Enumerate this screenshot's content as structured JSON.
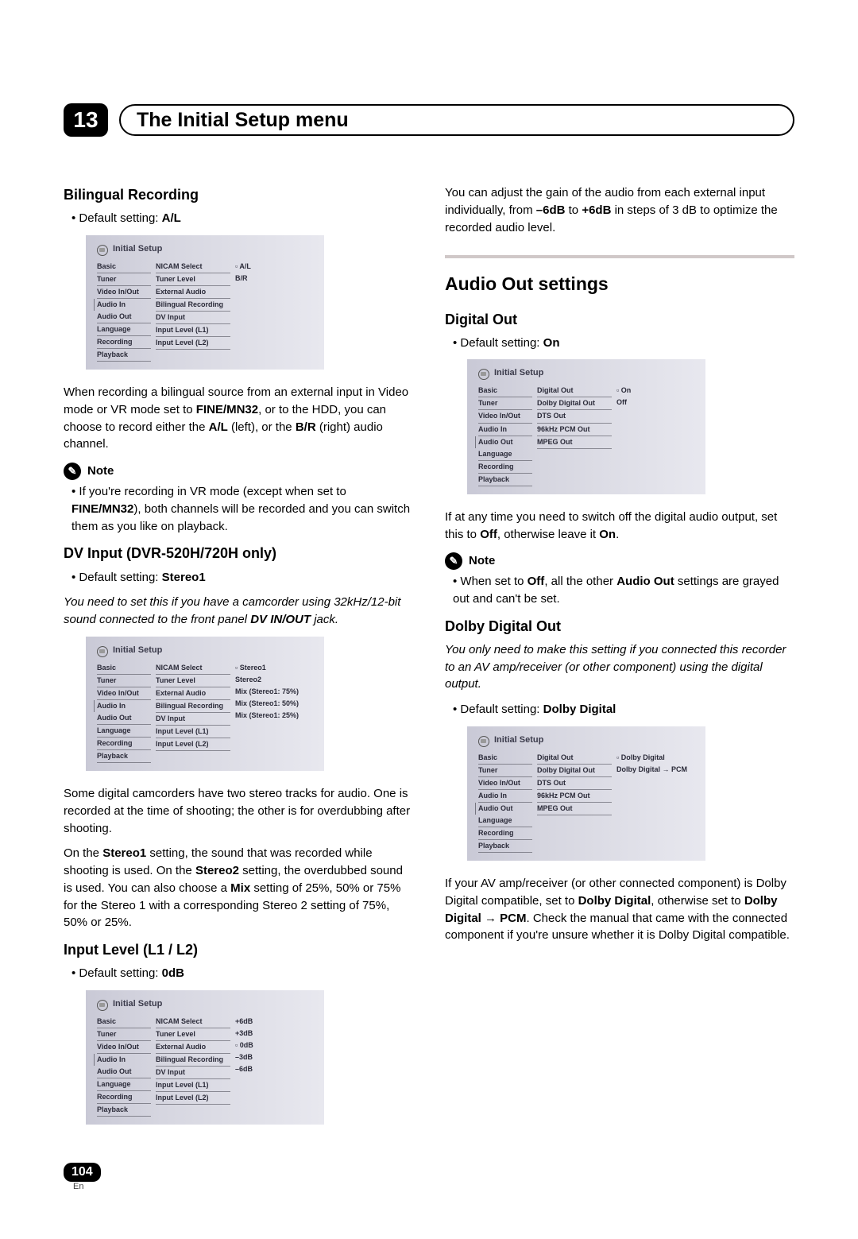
{
  "chapter": {
    "num": "13",
    "title": "The Initial Setup menu"
  },
  "page": {
    "num": "104",
    "lang": "En"
  },
  "default_label": "Default setting:",
  "note_label": "Note",
  "menu_header": "Initial Setup",
  "sidebar": [
    "Basic",
    "Tuner",
    "Video In/Out",
    "Audio In",
    "Audio Out",
    "Language",
    "Recording",
    "Playback"
  ],
  "audioin_mid": [
    "NICAM Select",
    "Tuner Level",
    "External Audio",
    "Bilingual Recording",
    "DV Input",
    "Input Level (L1)",
    "Input Level (L2)"
  ],
  "audioout_mid": [
    "Digital Out",
    "Dolby Digital Out",
    "DTS Out",
    "96kHz PCM Out",
    "MPEG Out"
  ],
  "bilingual": {
    "heading": "Bilingual Recording",
    "default": "A/L",
    "options": [
      "A/L",
      "B/R"
    ],
    "sel": 0,
    "body1": "When recording a bilingual source from an external input in Video mode or VR mode set to ",
    "b1": "FINE/MN32",
    "body2": ", or to the HDD, you can choose to record either the ",
    "b2": "A/L",
    "body3": " (left), or the ",
    "b3": "B/R",
    "body4": " (right) audio channel.",
    "note1": "If you're recording in VR mode (except when set to ",
    "note_b": "FINE/MN32",
    "note2": "), both channels will be recorded and you can switch them as you like on playback."
  },
  "dvinput": {
    "heading": "DV Input (DVR-520H/720H only)",
    "default": "Stereo1",
    "italic1": "You need to set this if you have a camcorder using 32kHz/12-bit sound connected to the front panel ",
    "italic_b": "DV IN/OUT",
    "italic2": " jack.",
    "options": [
      "Stereo1",
      "Stereo2",
      "Mix (Stereo1: 75%)",
      "Mix (Stereo1: 50%)",
      "Mix (Stereo1: 25%)"
    ],
    "sel": 0,
    "body1": "Some digital camcorders have two stereo tracks for audio. One is recorded at the time of shooting; the other is for overdubbing after shooting.",
    "body2a": "On the ",
    "body2b": "Stereo1",
    "body2c": " setting, the sound that was recorded while shooting is used. On the ",
    "body2d": "Stereo2",
    "body2e": " setting, the overdubbed sound is used. You can also choose a ",
    "body2f": "Mix",
    "body2g": " setting of 25%, 50% or 75% for the Stereo 1 with a corresponding Stereo 2 setting of 75%, 50% or 25%."
  },
  "inputlevel": {
    "heading": "Input Level (L1 / L2)",
    "default": "0dB",
    "options": [
      "+6dB",
      "+3dB",
      "0dB",
      "–3dB",
      "–6dB"
    ],
    "sel": 2
  },
  "gain": {
    "body1": "You can adjust the gain of the audio from each external input individually, from ",
    "b1": "–6dB",
    "mid": " to ",
    "b2": "+6dB",
    "body2": " in steps of 3 dB to optimize the recorded audio level."
  },
  "audioout": {
    "heading": "Audio Out settings"
  },
  "digitalout": {
    "heading": "Digital Out",
    "default": "On",
    "options": [
      "On",
      "Off"
    ],
    "sel": 0,
    "body1": "If at any time you need to switch off the digital audio output, set this to ",
    "b1": "Off",
    "mid": ", otherwise leave it ",
    "b2": "On",
    "end": ".",
    "note1": "When set to ",
    "note_b1": "Off",
    "note2": ", all the other ",
    "note_b2": "Audio Out",
    "note3": " settings are grayed out and can't be set."
  },
  "dolby": {
    "heading": "Dolby Digital Out",
    "italic": "You only need to make this setting if you connected this recorder to an AV amp/receiver (or other component) using the digital output.",
    "default": "Dolby Digital",
    "options": [
      "Dolby Digital",
      "Dolby Digital → PCM"
    ],
    "sel": 0,
    "body1": "If your AV amp/receiver (or other connected component) is Dolby Digital compatible, set to ",
    "b1": "Dolby Digital",
    "mid": ", otherwise set to ",
    "b2": "Dolby Digital → PCM",
    "body2": ". Check the manual that came with the connected component if you're unsure whether it is Dolby Digital compatible."
  }
}
